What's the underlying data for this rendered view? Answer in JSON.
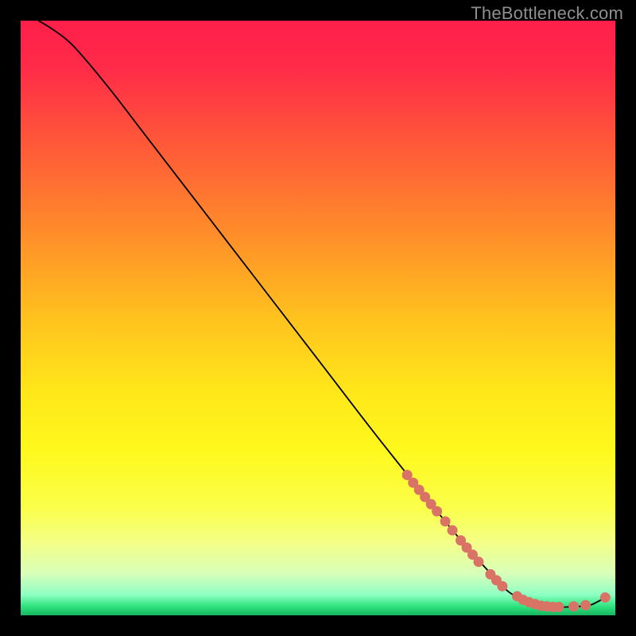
{
  "attribution": "TheBottleneck.com",
  "chart_data": {
    "type": "line",
    "title": "",
    "xlabel": "",
    "ylabel": "",
    "xlim": [
      0,
      100
    ],
    "ylim": [
      0,
      100
    ],
    "background": {
      "type": "vertical-gradient",
      "stops": [
        {
          "pos": 0.0,
          "color": "#ff1f4a"
        },
        {
          "pos": 0.08,
          "color": "#ff2b48"
        },
        {
          "pos": 0.2,
          "color": "#ff5639"
        },
        {
          "pos": 0.35,
          "color": "#ff8a2a"
        },
        {
          "pos": 0.5,
          "color": "#ffc21e"
        },
        {
          "pos": 0.62,
          "color": "#ffe61a"
        },
        {
          "pos": 0.72,
          "color": "#fff81c"
        },
        {
          "pos": 0.82,
          "color": "#faff4a"
        },
        {
          "pos": 0.88,
          "color": "#f3ff8a"
        },
        {
          "pos": 0.93,
          "color": "#d8ffba"
        },
        {
          "pos": 0.965,
          "color": "#8fffc4"
        },
        {
          "pos": 0.985,
          "color": "#2ee37d"
        },
        {
          "pos": 1.0,
          "color": "#17b560"
        }
      ]
    },
    "series": [
      {
        "name": "curve",
        "stroke": "#000000",
        "stroke_width": 1.8,
        "x": [
          3.0,
          5.0,
          7.5,
          10.0,
          15.0,
          20.0,
          30.0,
          40.0,
          50.0,
          60.0,
          70.0,
          75.0,
          80.0,
          82.0,
          84.0,
          86.0,
          88.0,
          90.0,
          92.0,
          94.0,
          96.0,
          98.3
        ],
        "y": [
          100.0,
          98.8,
          97.0,
          94.5,
          88.5,
          82.0,
          69.0,
          56.0,
          43.0,
          30.0,
          17.5,
          11.5,
          6.0,
          4.0,
          2.8,
          2.0,
          1.5,
          1.4,
          1.4,
          1.5,
          1.8,
          3.0
        ]
      }
    ],
    "highlight_points": {
      "name": "hotspots",
      "color": "#d97366",
      "radius": 6.5,
      "points": [
        {
          "x": 65.0,
          "y": 23.6
        },
        {
          "x": 66.0,
          "y": 22.3
        },
        {
          "x": 67.0,
          "y": 21.1
        },
        {
          "x": 68.0,
          "y": 19.9
        },
        {
          "x": 69.0,
          "y": 18.7
        },
        {
          "x": 70.0,
          "y": 17.5
        },
        {
          "x": 71.4,
          "y": 15.8
        },
        {
          "x": 72.6,
          "y": 14.3
        },
        {
          "x": 74.0,
          "y": 12.6
        },
        {
          "x": 75.0,
          "y": 11.4
        },
        {
          "x": 76.0,
          "y": 10.2
        },
        {
          "x": 77.0,
          "y": 9.0
        },
        {
          "x": 79.0,
          "y": 6.9
        },
        {
          "x": 80.0,
          "y": 5.9
        },
        {
          "x": 81.0,
          "y": 4.9
        },
        {
          "x": 83.5,
          "y": 3.2
        },
        {
          "x": 84.5,
          "y": 2.6
        },
        {
          "x": 85.5,
          "y": 2.2
        },
        {
          "x": 86.5,
          "y": 1.9
        },
        {
          "x": 87.5,
          "y": 1.6
        },
        {
          "x": 88.5,
          "y": 1.5
        },
        {
          "x": 89.5,
          "y": 1.4
        },
        {
          "x": 90.5,
          "y": 1.4
        },
        {
          "x": 93.0,
          "y": 1.5
        },
        {
          "x": 95.0,
          "y": 1.7
        },
        {
          "x": 98.3,
          "y": 3.0
        }
      ]
    }
  }
}
